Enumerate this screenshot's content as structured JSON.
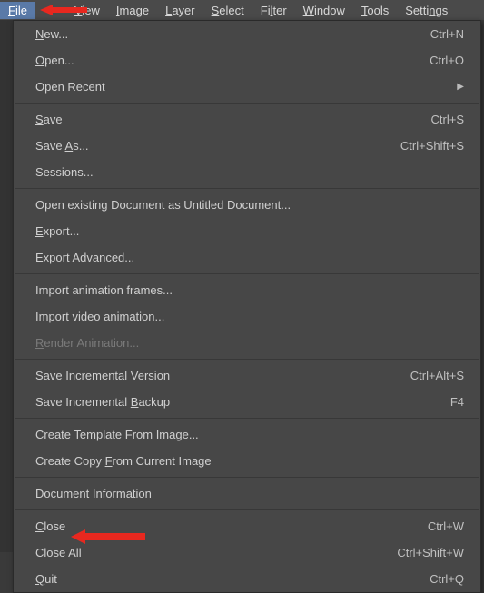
{
  "menubar": {
    "items": [
      {
        "label_pre": "",
        "key": "F",
        "label_post": "ile"
      },
      {
        "label_pre": "",
        "key": "",
        "label_post": ""
      },
      {
        "label_pre": "",
        "key": "V",
        "label_post": "iew"
      },
      {
        "label_pre": "",
        "key": "I",
        "label_post": "mage"
      },
      {
        "label_pre": "",
        "key": "L",
        "label_post": "ayer"
      },
      {
        "label_pre": "",
        "key": "S",
        "label_post": "elect"
      },
      {
        "label_pre": "Fi",
        "key": "l",
        "label_post": "ter"
      },
      {
        "label_pre": "",
        "key": "W",
        "label_post": "indow"
      },
      {
        "label_pre": "",
        "key": "T",
        "label_post": "ools"
      },
      {
        "label_pre": "Setti",
        "key": "n",
        "label_post": "gs"
      }
    ]
  },
  "file_menu": {
    "new": {
      "pre": "",
      "key": "N",
      "post": "ew...",
      "shortcut": "Ctrl+N"
    },
    "open": {
      "pre": "",
      "key": "O",
      "post": "pen...",
      "shortcut": "Ctrl+O"
    },
    "open_recent": {
      "label": "Open Recent"
    },
    "save": {
      "pre": "",
      "key": "S",
      "post": "ave",
      "shortcut": "Ctrl+S"
    },
    "save_as": {
      "pre": "Save ",
      "key": "A",
      "post": "s...",
      "shortcut": "Ctrl+Shift+S"
    },
    "sessions": {
      "label": "Sessions..."
    },
    "open_existing": {
      "label": "Open existing Document as Untitled Document..."
    },
    "export": {
      "pre": "",
      "key": "E",
      "post": "xport..."
    },
    "export_advanced": {
      "label": "Export Advanced..."
    },
    "import_frames": {
      "label": "Import animation frames..."
    },
    "import_video": {
      "label": "Import video animation..."
    },
    "render_animation": {
      "pre": "",
      "key": "R",
      "post": "ender Animation..."
    },
    "save_inc_version": {
      "pre": "Save Incremental ",
      "key": "V",
      "post": "ersion",
      "shortcut": "Ctrl+Alt+S"
    },
    "save_inc_backup": {
      "pre": "Save Incremental ",
      "key": "B",
      "post": "ackup",
      "shortcut": "F4"
    },
    "create_template": {
      "pre": "",
      "key": "C",
      "post": "reate Template From Image..."
    },
    "create_copy": {
      "pre": "Create Copy ",
      "key": "F",
      "post": "rom Current Image"
    },
    "doc_info": {
      "pre": "",
      "key": "D",
      "post": "ocument Information"
    },
    "close": {
      "pre": "",
      "key": "C",
      "post": "lose",
      "shortcut": "Ctrl+W"
    },
    "close_all": {
      "pre": "",
      "key": "C",
      "post": "lose All",
      "shortcut": "Ctrl+Shift+W"
    },
    "quit": {
      "pre": "",
      "key": "Q",
      "post": "uit",
      "shortcut": "Ctrl+Q"
    }
  },
  "arrow_color": "#e8281f"
}
